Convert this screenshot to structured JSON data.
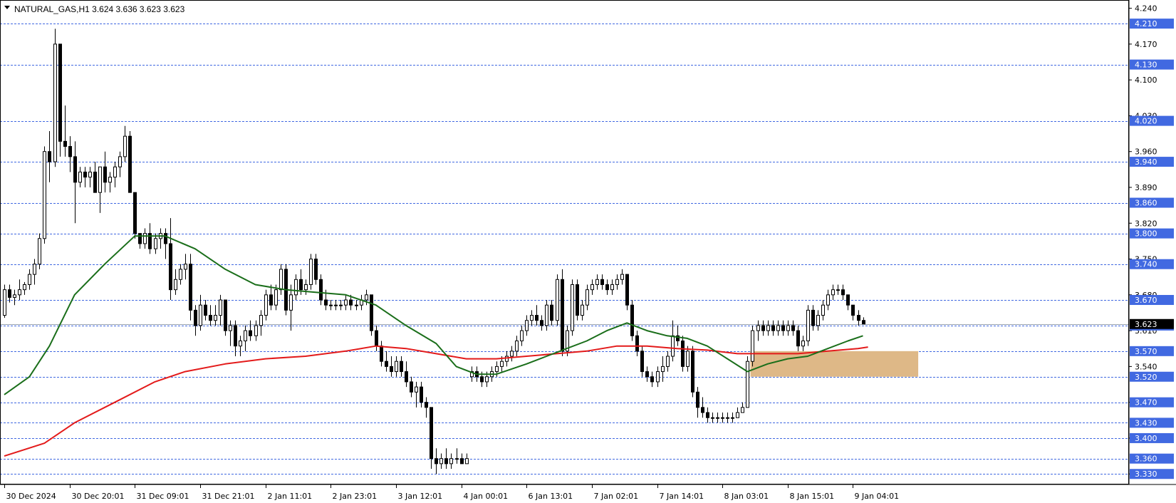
{
  "header": {
    "title": "NATURAL_GAS,H1  3.624 3.636 3.623 3.623"
  },
  "colors": {
    "background": "#ffffff",
    "candle_up_body": "#ffffff",
    "candle_down_body": "#000000",
    "candle_outline": "#000000",
    "level_line": "#4169e1",
    "level_box": "#4169e1",
    "current_price_box": "#000000",
    "ma_fast": "#1a6e1a",
    "ma_slow": "#e31a1a",
    "zone": "#deb887"
  },
  "chart_data": {
    "type": "candlestick",
    "symbol": "NATURAL_GAS",
    "timeframe": "H1",
    "ohlc_header": {
      "open": 3.624,
      "high": 3.636,
      "low": 3.623,
      "close": 3.623
    },
    "ylim": [
      3.315,
      4.245
    ],
    "y_ticks": [
      "4.240",
      "4.170",
      "4.100",
      "4.030",
      "3.960",
      "3.890",
      "3.820",
      "3.750",
      "3.680",
      "3.610",
      "3.540",
      "3.470",
      "3.400",
      "3.330"
    ],
    "x_ticks": [
      "30 Dec 2024",
      "30 Dec 20:01",
      "31 Dec 09:01",
      "31 Dec 21:01",
      "2 Jan 11:01",
      "2 Jan 23:01",
      "3 Jan 12:01",
      "4 Jan 00:01",
      "6 Jan 13:01",
      "7 Jan 02:01",
      "7 Jan 14:01",
      "8 Jan 03:01",
      "8 Jan 15:01",
      "9 Jan 04:01"
    ],
    "x_tick_bar_index": [
      0,
      13,
      26,
      39,
      52,
      65,
      78,
      91,
      104,
      117,
      130,
      143,
      156,
      169
    ],
    "levels": [
      4.21,
      4.13,
      4.02,
      3.94,
      3.86,
      3.8,
      3.74,
      3.67,
      3.62,
      3.57,
      3.52,
      3.47,
      3.43,
      3.4,
      3.36,
      3.33
    ],
    "level_labels": [
      "4.210",
      "4.130",
      "4.020",
      "3.940",
      "3.860",
      "3.800",
      "3.740",
      "3.670",
      "3.620",
      "3.570",
      "3.520",
      "3.470",
      "3.430",
      "3.400",
      "3.360",
      "3.330"
    ],
    "current_price": "3.623",
    "zone": {
      "bar_start": 149,
      "bar_end": 182,
      "price_low": 3.52,
      "price_high": 3.57
    },
    "candles": [
      [
        3.64,
        3.7,
        3.635,
        3.69
      ],
      [
        3.69,
        3.7,
        3.665,
        3.675
      ],
      [
        3.675,
        3.69,
        3.66,
        3.68
      ],
      [
        3.68,
        3.71,
        3.67,
        3.69
      ],
      [
        3.69,
        3.705,
        3.68,
        3.7
      ],
      [
        3.7,
        3.73,
        3.69,
        3.72
      ],
      [
        3.72,
        3.75,
        3.7,
        3.74
      ],
      [
        3.74,
        3.8,
        3.73,
        3.79
      ],
      [
        3.79,
        3.97,
        3.78,
        3.96
      ],
      [
        3.96,
        4.0,
        3.9,
        3.94
      ],
      [
        3.94,
        4.2,
        3.93,
        4.17
      ],
      [
        4.17,
        4.17,
        3.95,
        3.98
      ],
      [
        3.98,
        4.05,
        3.95,
        3.97
      ],
      [
        3.97,
        3.99,
        3.92,
        3.95
      ],
      [
        3.95,
        3.98,
        3.82,
        3.9
      ],
      [
        3.9,
        3.93,
        3.89,
        3.92
      ],
      [
        3.92,
        3.93,
        3.89,
        3.91
      ],
      [
        3.91,
        3.93,
        3.89,
        3.92
      ],
      [
        3.92,
        3.94,
        3.88,
        3.88
      ],
      [
        3.88,
        3.93,
        3.84,
        3.93
      ],
      [
        3.93,
        3.96,
        3.88,
        3.9
      ],
      [
        3.9,
        3.92,
        3.88,
        3.91
      ],
      [
        3.91,
        3.94,
        3.89,
        3.93
      ],
      [
        3.93,
        3.96,
        3.91,
        3.95
      ],
      [
        3.95,
        4.01,
        3.94,
        3.99
      ],
      [
        3.99,
        4.0,
        3.88,
        3.88
      ],
      [
        3.88,
        3.88,
        3.79,
        3.8
      ],
      [
        3.8,
        3.8,
        3.77,
        3.78
      ],
      [
        3.78,
        3.81,
        3.77,
        3.8
      ],
      [
        3.8,
        3.82,
        3.76,
        3.77
      ],
      [
        3.77,
        3.8,
        3.76,
        3.79
      ],
      [
        3.79,
        3.81,
        3.77,
        3.8
      ],
      [
        3.8,
        3.81,
        3.75,
        3.78
      ],
      [
        3.78,
        3.83,
        3.67,
        3.69
      ],
      [
        3.69,
        3.73,
        3.68,
        3.71
      ],
      [
        3.71,
        3.74,
        3.7,
        3.73
      ],
      [
        3.73,
        3.76,
        3.71,
        3.74
      ],
      [
        3.74,
        3.76,
        3.63,
        3.65
      ],
      [
        3.65,
        3.66,
        3.6,
        3.62
      ],
      [
        3.62,
        3.68,
        3.61,
        3.66
      ],
      [
        3.66,
        3.67,
        3.63,
        3.64
      ],
      [
        3.64,
        3.66,
        3.62,
        3.63
      ],
      [
        3.63,
        3.66,
        3.62,
        3.64
      ],
      [
        3.64,
        3.68,
        3.62,
        3.67
      ],
      [
        3.67,
        3.67,
        3.6,
        3.61
      ],
      [
        3.61,
        3.63,
        3.58,
        3.62
      ],
      [
        3.62,
        3.63,
        3.56,
        3.58
      ],
      [
        3.58,
        3.6,
        3.56,
        3.59
      ],
      [
        3.59,
        3.62,
        3.57,
        3.61
      ],
      [
        3.61,
        3.63,
        3.59,
        3.6
      ],
      [
        3.6,
        3.63,
        3.59,
        3.62
      ],
      [
        3.62,
        3.65,
        3.6,
        3.64
      ],
      [
        3.64,
        3.69,
        3.63,
        3.68
      ],
      [
        3.68,
        3.7,
        3.65,
        3.66
      ],
      [
        3.66,
        3.7,
        3.65,
        3.69
      ],
      [
        3.69,
        3.74,
        3.68,
        3.73
      ],
      [
        3.73,
        3.74,
        3.64,
        3.65
      ],
      [
        3.65,
        3.7,
        3.61,
        3.68
      ],
      [
        3.68,
        3.72,
        3.67,
        3.71
      ],
      [
        3.71,
        3.73,
        3.68,
        3.69
      ],
      [
        3.69,
        3.71,
        3.68,
        3.7
      ],
      [
        3.7,
        3.76,
        3.69,
        3.75
      ],
      [
        3.75,
        3.76,
        3.7,
        3.71
      ],
      [
        3.71,
        3.72,
        3.66,
        3.67
      ],
      [
        3.67,
        3.69,
        3.65,
        3.66
      ],
      [
        3.66,
        3.67,
        3.65,
        3.66
      ],
      [
        3.66,
        3.67,
        3.65,
        3.66
      ],
      [
        3.66,
        3.67,
        3.65,
        3.66
      ],
      [
        3.66,
        3.68,
        3.65,
        3.67
      ],
      [
        3.67,
        3.68,
        3.65,
        3.66
      ],
      [
        3.66,
        3.67,
        3.65,
        3.66
      ],
      [
        3.66,
        3.68,
        3.65,
        3.67
      ],
      [
        3.67,
        3.69,
        3.66,
        3.68
      ],
      [
        3.68,
        3.68,
        3.6,
        3.61
      ],
      [
        3.61,
        3.62,
        3.57,
        3.58
      ],
      [
        3.58,
        3.59,
        3.54,
        3.55
      ],
      [
        3.55,
        3.57,
        3.53,
        3.54
      ],
      [
        3.54,
        3.56,
        3.52,
        3.53
      ],
      [
        3.53,
        3.56,
        3.52,
        3.55
      ],
      [
        3.55,
        3.56,
        3.52,
        3.53
      ],
      [
        3.53,
        3.55,
        3.5,
        3.51
      ],
      [
        3.51,
        3.52,
        3.48,
        3.49
      ],
      [
        3.49,
        3.51,
        3.46,
        3.5
      ],
      [
        3.5,
        3.51,
        3.46,
        3.47
      ],
      [
        3.47,
        3.48,
        3.44,
        3.46
      ],
      [
        3.46,
        3.46,
        3.34,
        3.36
      ],
      [
        3.36,
        3.38,
        3.33,
        3.35
      ],
      [
        3.35,
        3.37,
        3.34,
        3.36
      ],
      [
        3.36,
        3.38,
        3.34,
        3.35
      ],
      [
        3.35,
        3.37,
        3.34,
        3.36
      ],
      [
        3.36,
        3.38,
        3.35,
        3.36
      ],
      [
        3.36,
        3.37,
        3.35,
        3.35
      ],
      [
        3.35,
        3.37,
        3.35,
        3.36
      ],
      [
        3.52,
        3.54,
        3.51,
        3.53
      ],
      [
        3.53,
        3.54,
        3.51,
        3.52
      ],
      [
        3.52,
        3.53,
        3.5,
        3.51
      ],
      [
        3.51,
        3.53,
        3.5,
        3.52
      ],
      [
        3.52,
        3.54,
        3.51,
        3.53
      ],
      [
        3.53,
        3.55,
        3.52,
        3.54
      ],
      [
        3.54,
        3.56,
        3.53,
        3.55
      ],
      [
        3.55,
        3.57,
        3.54,
        3.56
      ],
      [
        3.56,
        3.58,
        3.55,
        3.57
      ],
      [
        3.57,
        3.6,
        3.56,
        3.59
      ],
      [
        3.59,
        3.62,
        3.58,
        3.61
      ],
      [
        3.61,
        3.64,
        3.6,
        3.63
      ],
      [
        3.63,
        3.65,
        3.62,
        3.64
      ],
      [
        3.64,
        3.66,
        3.62,
        3.63
      ],
      [
        3.63,
        3.64,
        3.61,
        3.62
      ],
      [
        3.62,
        3.67,
        3.61,
        3.66
      ],
      [
        3.66,
        3.67,
        3.62,
        3.63
      ],
      [
        3.63,
        3.72,
        3.62,
        3.71
      ],
      [
        3.71,
        3.73,
        3.56,
        3.57
      ],
      [
        3.57,
        3.62,
        3.56,
        3.61
      ],
      [
        3.61,
        3.71,
        3.6,
        3.7
      ],
      [
        3.7,
        3.71,
        3.63,
        3.64
      ],
      [
        3.64,
        3.67,
        3.63,
        3.66
      ],
      [
        3.66,
        3.7,
        3.65,
        3.69
      ],
      [
        3.69,
        3.71,
        3.68,
        3.7
      ],
      [
        3.7,
        3.72,
        3.69,
        3.71
      ],
      [
        3.71,
        3.72,
        3.69,
        3.7
      ],
      [
        3.7,
        3.71,
        3.68,
        3.69
      ],
      [
        3.69,
        3.71,
        3.68,
        3.7
      ],
      [
        3.7,
        3.72,
        3.69,
        3.71
      ],
      [
        3.71,
        3.73,
        3.7,
        3.72
      ],
      [
        3.72,
        3.72,
        3.65,
        3.66
      ],
      [
        3.66,
        3.67,
        3.59,
        3.6
      ],
      [
        3.6,
        3.61,
        3.56,
        3.57
      ],
      [
        3.57,
        3.58,
        3.52,
        3.53
      ],
      [
        3.53,
        3.54,
        3.51,
        3.52
      ],
      [
        3.52,
        3.53,
        3.5,
        3.51
      ],
      [
        3.51,
        3.54,
        3.5,
        3.53
      ],
      [
        3.53,
        3.56,
        3.51,
        3.54
      ],
      [
        3.54,
        3.57,
        3.53,
        3.56
      ],
      [
        3.56,
        3.63,
        3.55,
        3.6
      ],
      [
        3.6,
        3.62,
        3.58,
        3.59
      ],
      [
        3.59,
        3.6,
        3.53,
        3.54
      ],
      [
        3.54,
        3.58,
        3.53,
        3.57
      ],
      [
        3.57,
        3.58,
        3.48,
        3.49
      ],
      [
        3.49,
        3.5,
        3.44,
        3.46
      ],
      [
        3.46,
        3.48,
        3.44,
        3.45
      ],
      [
        3.45,
        3.46,
        3.43,
        3.44
      ],
      [
        3.44,
        3.45,
        3.43,
        3.44
      ],
      [
        3.44,
        3.45,
        3.43,
        3.44
      ],
      [
        3.44,
        3.45,
        3.43,
        3.44
      ],
      [
        3.44,
        3.45,
        3.43,
        3.44
      ],
      [
        3.44,
        3.45,
        3.43,
        3.44
      ],
      [
        3.44,
        3.46,
        3.44,
        3.45
      ],
      [
        3.45,
        3.47,
        3.45,
        3.46
      ],
      [
        3.46,
        3.56,
        3.46,
        3.55
      ],
      [
        3.55,
        3.62,
        3.54,
        3.61
      ],
      [
        3.61,
        3.63,
        3.59,
        3.62
      ],
      [
        3.62,
        3.63,
        3.6,
        3.61
      ],
      [
        3.61,
        3.63,
        3.6,
        3.62
      ],
      [
        3.62,
        3.63,
        3.6,
        3.61
      ],
      [
        3.61,
        3.63,
        3.6,
        3.62
      ],
      [
        3.62,
        3.63,
        3.6,
        3.61
      ],
      [
        3.61,
        3.63,
        3.6,
        3.62
      ],
      [
        3.62,
        3.63,
        3.6,
        3.61
      ],
      [
        3.61,
        3.62,
        3.57,
        3.58
      ],
      [
        3.58,
        3.6,
        3.57,
        3.59
      ],
      [
        3.59,
        3.66,
        3.58,
        3.65
      ],
      [
        3.65,
        3.66,
        3.61,
        3.62
      ],
      [
        3.62,
        3.65,
        3.61,
        3.64
      ],
      [
        3.64,
        3.67,
        3.63,
        3.66
      ],
      [
        3.66,
        3.69,
        3.65,
        3.68
      ],
      [
        3.68,
        3.7,
        3.67,
        3.69
      ],
      [
        3.69,
        3.7,
        3.68,
        3.69
      ],
      [
        3.69,
        3.7,
        3.67,
        3.68
      ],
      [
        3.68,
        3.68,
        3.65,
        3.66
      ],
      [
        3.66,
        3.66,
        3.63,
        3.64
      ],
      [
        3.64,
        3.65,
        3.62,
        3.63
      ],
      [
        3.63,
        3.636,
        3.623,
        3.623
      ]
    ],
    "ma_fast": [
      [
        0,
        3.485
      ],
      [
        5,
        3.52
      ],
      [
        9,
        3.58
      ],
      [
        14,
        3.68
      ],
      [
        20,
        3.74
      ],
      [
        26,
        3.795
      ],
      [
        32,
        3.795
      ],
      [
        38,
        3.77
      ],
      [
        44,
        3.73
      ],
      [
        50,
        3.7
      ],
      [
        56,
        3.69
      ],
      [
        62,
        3.685
      ],
      [
        68,
        3.68
      ],
      [
        74,
        3.66
      ],
      [
        80,
        3.62
      ],
      [
        86,
        3.585
      ],
      [
        90,
        3.54
      ],
      [
        94,
        3.525
      ],
      [
        98,
        3.525
      ],
      [
        104,
        3.545
      ],
      [
        108,
        3.56
      ],
      [
        112,
        3.575
      ],
      [
        116,
        3.59
      ],
      [
        120,
        3.61
      ],
      [
        124,
        3.625
      ],
      [
        128,
        3.61
      ],
      [
        132,
        3.6
      ],
      [
        136,
        3.595
      ],
      [
        140,
        3.58
      ],
      [
        144,
        3.555
      ],
      [
        148,
        3.53
      ],
      [
        152,
        3.545
      ],
      [
        156,
        3.555
      ],
      [
        160,
        3.56
      ],
      [
        164,
        3.575
      ],
      [
        168,
        3.59
      ],
      [
        171,
        3.6
      ]
    ],
    "ma_slow": [
      [
        0,
        3.365
      ],
      [
        8,
        3.39
      ],
      [
        14,
        3.43
      ],
      [
        22,
        3.47
      ],
      [
        30,
        3.51
      ],
      [
        36,
        3.53
      ],
      [
        44,
        3.545
      ],
      [
        52,
        3.555
      ],
      [
        60,
        3.56
      ],
      [
        68,
        3.57
      ],
      [
        74,
        3.58
      ],
      [
        80,
        3.575
      ],
      [
        86,
        3.565
      ],
      [
        92,
        3.555
      ],
      [
        98,
        3.555
      ],
      [
        104,
        3.56
      ],
      [
        110,
        3.565
      ],
      [
        116,
        3.57
      ],
      [
        122,
        3.58
      ],
      [
        128,
        3.58
      ],
      [
        134,
        3.575
      ],
      [
        140,
        3.572
      ],
      [
        146,
        3.565
      ],
      [
        152,
        3.565
      ],
      [
        158,
        3.565
      ],
      [
        164,
        3.57
      ],
      [
        170,
        3.575
      ],
      [
        172,
        3.578
      ]
    ]
  }
}
